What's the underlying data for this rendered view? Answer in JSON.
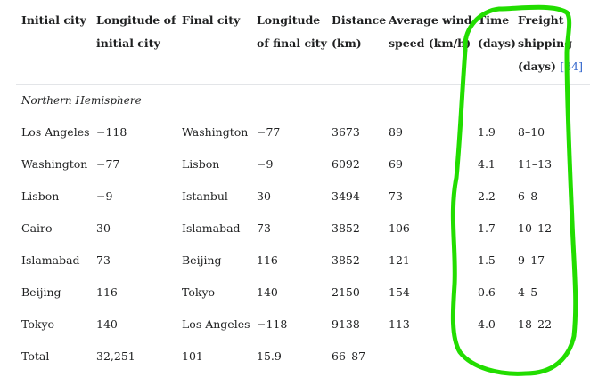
{
  "table": {
    "headers": [
      {
        "line1": "Initial city",
        "line2": ""
      },
      {
        "line1": "Longitude of",
        "line2": "initial city"
      },
      {
        "line1": "Final city",
        "line2": ""
      },
      {
        "line1": "Longitude",
        "line2": "of final city"
      },
      {
        "line1": "Distance",
        "line2": "(km)"
      },
      {
        "line1": "Average wind",
        "line2": "speed (km/h)"
      },
      {
        "line1": "Time",
        "line2": "(days)"
      },
      {
        "line1": "Freight",
        "line2": "shipping",
        "line3": "(days)",
        "ref": "[84]"
      }
    ],
    "section_label": "Northern Hemisphere",
    "rows": [
      [
        "Los Angeles",
        "−118",
        "Washington",
        "−77",
        "3673",
        "89",
        "1.9",
        "8–10"
      ],
      [
        "Washington",
        "−77",
        "Lisbon",
        "−9",
        "6092",
        "69",
        "4.1",
        "11–13"
      ],
      [
        "Lisbon",
        "−9",
        "Istanbul",
        "30",
        "3494",
        "73",
        "2.2",
        "6–8"
      ],
      [
        "Cairo",
        "30",
        "Islamabad",
        "73",
        "3852",
        "106",
        "1.7",
        "10–12"
      ],
      [
        "Islamabad",
        "73",
        "Beijing",
        "116",
        "3852",
        "121",
        "1.5",
        "9–17"
      ],
      [
        "Beijing",
        "116",
        "Tokyo",
        "140",
        "2150",
        "154",
        "0.6",
        "4–5"
      ],
      [
        "Tokyo",
        "140",
        "Los Angeles",
        "−118",
        "9138",
        "113",
        "4.0",
        "18–22"
      ]
    ],
    "total_row": [
      "Total",
      "32,251",
      "101",
      "15.9",
      "66–87"
    ]
  },
  "annotation": {
    "color": "#22dd00"
  }
}
